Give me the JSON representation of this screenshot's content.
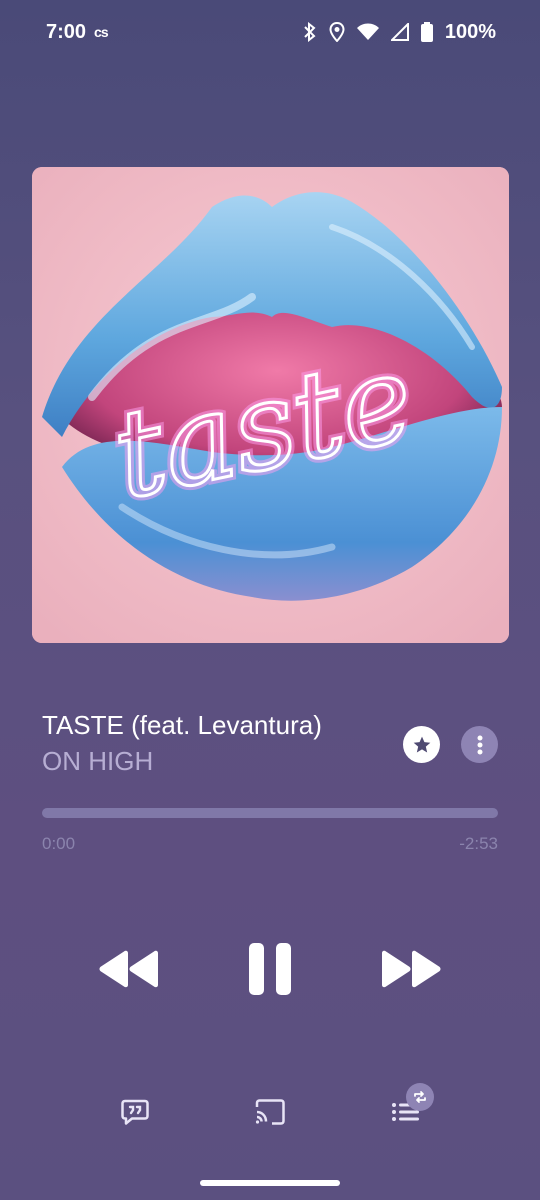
{
  "status_bar": {
    "time": "7:00",
    "carrier_icon": "cs",
    "battery": "100%",
    "icons": [
      "bluetooth-icon",
      "location-icon",
      "wifi-icon",
      "cellular-icon",
      "battery-icon"
    ]
  },
  "artwork": {
    "name": "album-artwork",
    "text": "taste"
  },
  "now_playing": {
    "title": "TASTE (feat. Levantura)",
    "artist": "ON HIGH"
  },
  "progress": {
    "elapsed": "0:00",
    "remaining": "-2:53",
    "fraction": 0.0
  },
  "controls": {
    "rewind": "rewind-icon",
    "pause": "pause-icon",
    "forward": "forward-icon"
  },
  "bottom_bar": {
    "lyrics": "lyrics-icon",
    "cast": "cast-icon",
    "queue": "queue-icon",
    "queue_badge": "repeat-icon"
  },
  "colors": {
    "accent": "#8e84b4",
    "artist_text": "#b7aed3",
    "time_text": "#8b84ad"
  }
}
